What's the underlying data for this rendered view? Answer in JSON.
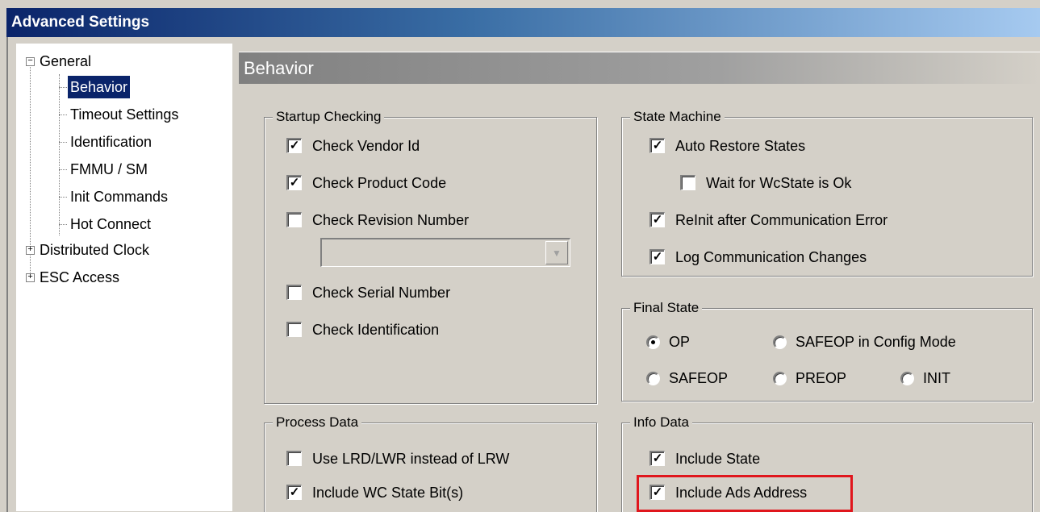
{
  "window": {
    "title": "Advanced Settings"
  },
  "tree": {
    "general": "General",
    "behavior": "Behavior",
    "timeout": "Timeout Settings",
    "identification": "Identification",
    "fmmu": "FMMU / SM",
    "init": "Init Commands",
    "hot": "Hot Connect",
    "dc": "Distributed Clock",
    "esc": "ESC Access",
    "expanded_glyph": "−",
    "collapsed_glyph": "+"
  },
  "header": {
    "title": "Behavior"
  },
  "startup": {
    "title": "Startup Checking",
    "vendor": "Check Vendor Id",
    "product": "Check Product Code",
    "revision": "Check Revision Number",
    "serial": "Check Serial Number",
    "ident": "Check Identification",
    "revision_value": ""
  },
  "state_machine": {
    "title": "State Machine",
    "auto": "Auto Restore States",
    "wait": "Wait for WcState is Ok",
    "reinit": "ReInit after Communication Error",
    "log": "Log Communication Changes"
  },
  "final_state": {
    "title": "Final State",
    "op": "OP",
    "safeop_cfg": "SAFEOP in Config Mode",
    "safeop": "SAFEOP",
    "preop": "PREOP",
    "init": "INIT",
    "selected": "OP"
  },
  "process_data": {
    "title": "Process Data",
    "lrd": "Use LRD/LWR instead of LRW",
    "wc": "Include WC State Bit(s)"
  },
  "info_data": {
    "title": "Info Data",
    "state": "Include State",
    "ads": "Include Ads Address"
  },
  "check_mark": "✓",
  "highlight_color": "#e0161d"
}
